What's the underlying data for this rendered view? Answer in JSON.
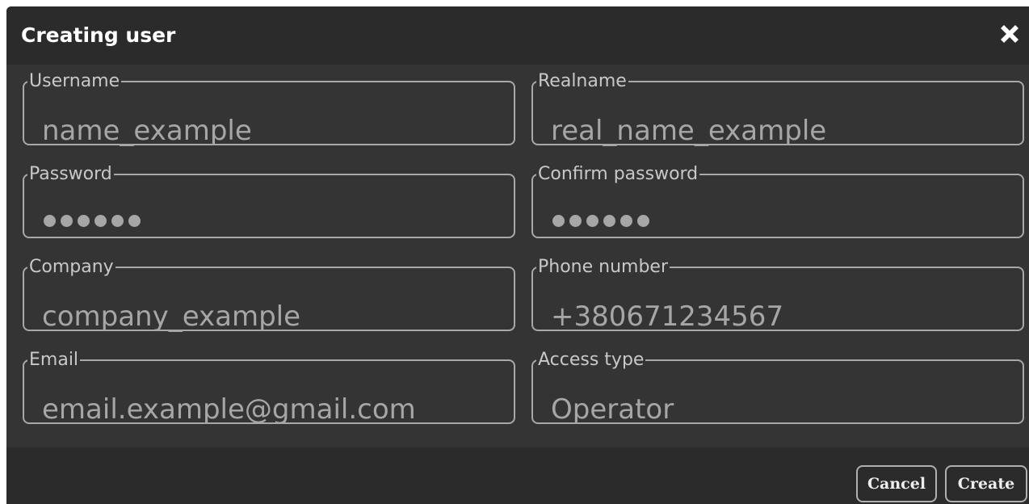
{
  "dialog": {
    "title": "Creating user",
    "close_icon": "close-icon"
  },
  "fields": {
    "username": {
      "label": "Username",
      "value": "name_example"
    },
    "realname": {
      "label": "Realname",
      "value": "real_name_example"
    },
    "password": {
      "label": "Password",
      "value": "••••••"
    },
    "confirm_password": {
      "label": "Confirm password",
      "value": "••••••"
    },
    "company": {
      "label": "Company",
      "value": "company_example"
    },
    "phone": {
      "label": "Phone number",
      "value": "+380671234567"
    },
    "email": {
      "label": "Email",
      "value": "email.example@gmail.com"
    },
    "access_type": {
      "label": "Access type",
      "value": "Operator"
    }
  },
  "footer": {
    "cancel_label": "Cancel",
    "create_label": "Create"
  },
  "colors": {
    "dialog_bg": "#2b2b2b",
    "body_bg": "#343434",
    "border": "#a8a8a8",
    "label": "#c8c8c8",
    "value": "#a6a6a6",
    "title": "#ffffff"
  }
}
